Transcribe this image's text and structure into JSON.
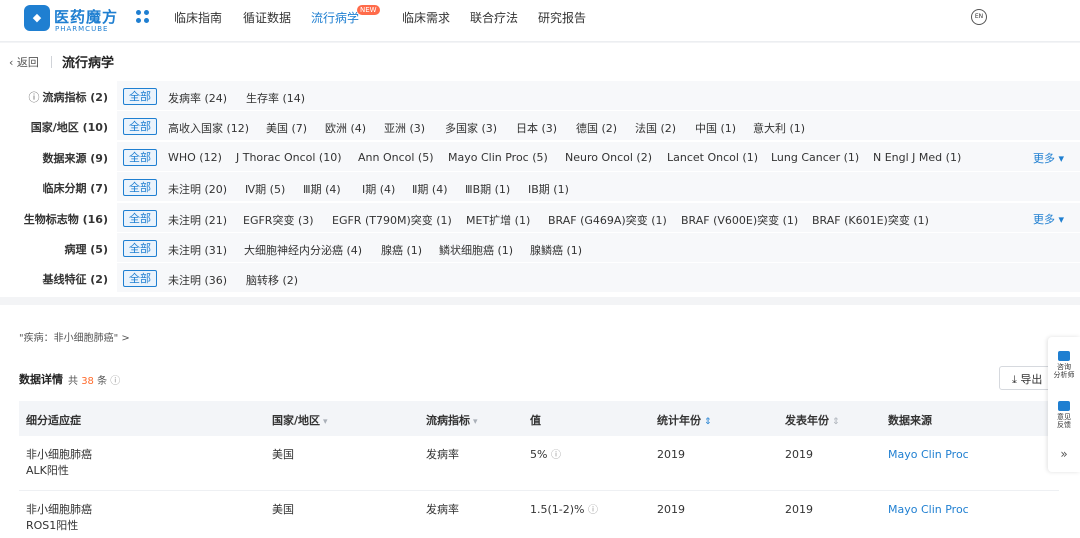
{
  "header": {
    "logo_text": "医药魔方",
    "logo_sub": "PHARMCUBE",
    "nav": [
      "临床指南",
      "循证数据",
      "流行病学",
      "临床需求",
      "联合疗法",
      "研究报告"
    ],
    "new_badge": "NEW",
    "lang": "EN"
  },
  "breadcrumb": {
    "back": "返回",
    "title": "流行病学"
  },
  "filters": {
    "all_label": "全部",
    "more_label": "更多",
    "rows": [
      {
        "label": "流病指标 (2)",
        "options": [
          "发病率 (24)",
          "生存率 (14)"
        ]
      },
      {
        "label": "国家/地区 (10)",
        "options": [
          "高收入国家 (12)",
          "美国 (7)",
          "欧洲 (4)",
          "亚洲 (3)",
          "多国家 (3)",
          "日本 (3)",
          "德国 (2)",
          "法国 (2)",
          "中国 (1)",
          "意大利 (1)"
        ]
      },
      {
        "label": "数据来源 (9)",
        "options": [
          "WHO (12)",
          "J Thorac Oncol (10)",
          "Ann Oncol (5)",
          "Mayo Clin Proc (5)",
          "Neuro Oncol (2)",
          "Lancet Oncol (1)",
          "Lung Cancer (1)",
          "N Engl J Med (1)"
        ]
      },
      {
        "label": "临床分期 (7)",
        "options": [
          "未注明 (20)",
          "Ⅳ期 (5)",
          "Ⅲ期 (4)",
          "Ⅰ期 (4)",
          "Ⅱ期 (4)",
          "ⅢB期 (1)",
          "ⅠB期 (1)"
        ]
      },
      {
        "label": "生物标志物 (16)",
        "options": [
          "未注明 (21)",
          "EGFR突变 (3)",
          "EGFR (T790M)突变 (1)",
          "MET扩增 (1)",
          "BRAF (G469A)突变 (1)",
          "BRAF (V600E)突变 (1)",
          "BRAF (K601E)突变 (1)"
        ]
      },
      {
        "label": "病理 (5)",
        "options": [
          "未注明 (31)",
          "大细胞神经内分泌癌 (4)",
          "腺癌 (1)",
          "鳞状细胞癌 (1)",
          "腺鳞癌 (1)"
        ]
      },
      {
        "label": "基线特征 (2)",
        "options": [
          "未注明 (36)",
          "脑转移 (2)"
        ]
      }
    ]
  },
  "results": {
    "disease_tag": "\"疾病：非小细胞肺癌\" >",
    "title": "数据详情",
    "count_prefix": "共",
    "count": "38",
    "count_suffix": "条",
    "export": "导出",
    "columns": [
      "细分适应症",
      "国家/地区",
      "流病指标",
      "值",
      "统计年份",
      "发表年份",
      "数据来源"
    ],
    "rows": [
      {
        "ind1": "非小细胞肺癌",
        "ind2": "ALK阳性",
        "country": "美国",
        "metric": "发病率",
        "value": "5%",
        "stat_year": "2019",
        "pub_year": "2019",
        "source": "Mayo Clin Proc"
      },
      {
        "ind1": "非小细胞肺癌",
        "ind2": "ROS1阳性",
        "country": "美国",
        "metric": "发病率",
        "value": "1.5(1-2)%",
        "stat_year": "2019",
        "pub_year": "2019",
        "source": "Mayo Clin Proc"
      }
    ]
  },
  "side_float": {
    "consult": [
      "咨询",
      "分析师"
    ],
    "feedback": [
      "意见",
      "反馈"
    ],
    "collapse": "»"
  }
}
